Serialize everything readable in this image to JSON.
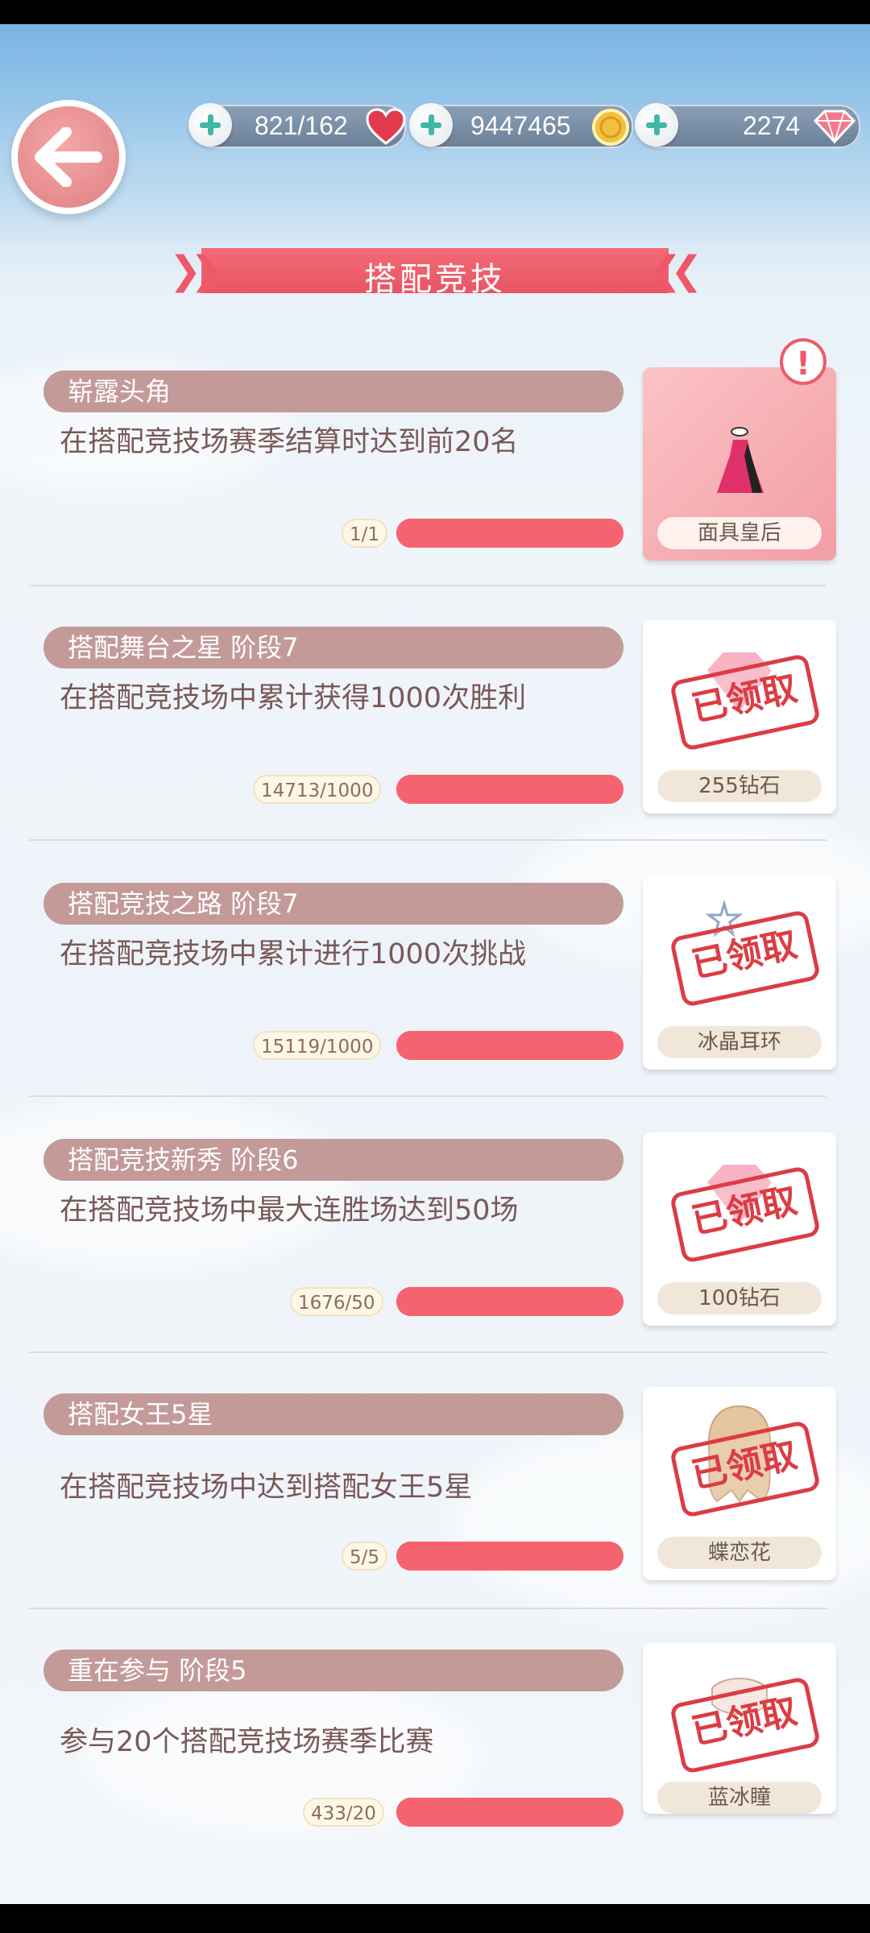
{
  "header": {
    "resources": [
      {
        "name": "stamina",
        "value": "821/162",
        "icon": "heart-icon",
        "icon_color": "#e23a4c"
      },
      {
        "name": "gold",
        "value": "9447465",
        "icon": "gold-coin-icon",
        "icon_color": "#f1c040"
      },
      {
        "name": "diamond",
        "value": "2274",
        "icon": "diamond-icon",
        "icon_color": "#f6788b"
      }
    ]
  },
  "page": {
    "title": "搭配竞技"
  },
  "achievements": [
    {
      "badge": "崭露头角",
      "desc": "在搭配竞技场赛季结算时达到前20名",
      "progress": "1/1",
      "reward": "面具皇后",
      "claimed": false,
      "alert": "!"
    },
    {
      "badge": "搭配舞台之星 阶段7",
      "desc": "在搭配竞技场中累计获得1000次胜利",
      "progress": "14713/1000",
      "reward": "255钻石",
      "claimed": true,
      "stamp": "已领取"
    },
    {
      "badge": "搭配竞技之路 阶段7",
      "desc": "在搭配竞技场中累计进行1000次挑战",
      "progress": "15119/1000",
      "reward": "冰晶耳环",
      "claimed": true,
      "stamp": "已领取"
    },
    {
      "badge": "搭配竞技新秀 阶段6",
      "desc": "在搭配竞技场中最大连胜场达到50场",
      "progress": "1676/50",
      "reward": "100钻石",
      "claimed": true,
      "stamp": "已领取"
    },
    {
      "badge": "搭配女王5星",
      "desc": "在搭配竞技场中达到搭配女王5星",
      "progress": "5/5",
      "reward": "蝶恋花",
      "claimed": true,
      "stamp": "已领取"
    },
    {
      "badge": "重在参与 阶段5",
      "desc": "参与20个搭配竞技场赛季比赛",
      "progress": "433/20",
      "reward": "蓝冰瞳",
      "claimed": true,
      "stamp": "已领取"
    }
  ],
  "colors": {
    "accent": "#f5646e",
    "badge": "#c39a98",
    "stamp": "#dc3c44"
  }
}
